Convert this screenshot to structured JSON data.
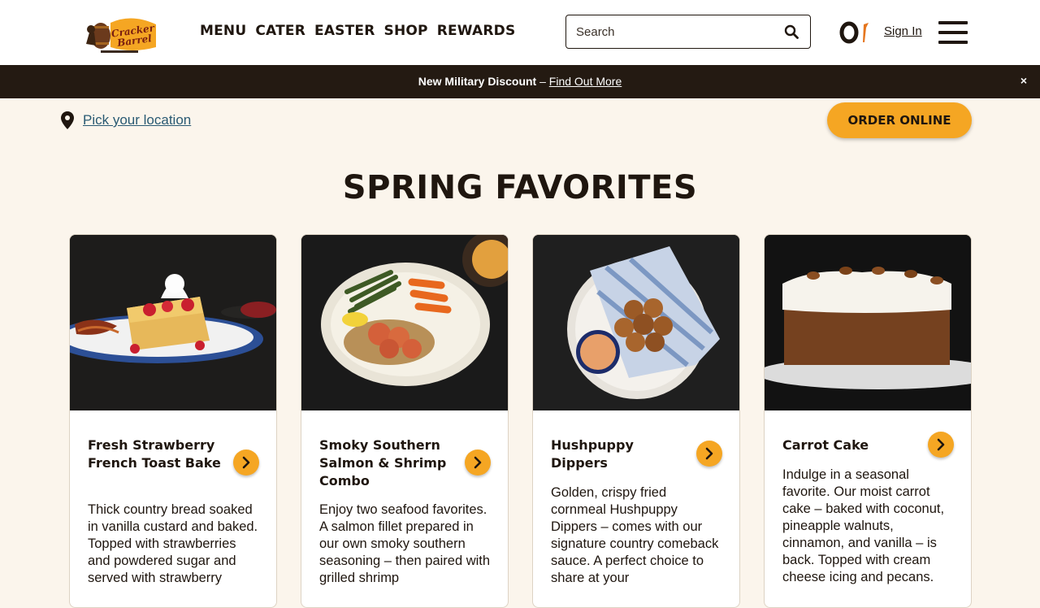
{
  "brand": {
    "logo_alt": "Cracker Barrel Old Country Store"
  },
  "nav": {
    "items": [
      "MENU",
      "CATER",
      "EASTER",
      "SHOP",
      "REWARDS"
    ]
  },
  "search": {
    "placeholder": "Search"
  },
  "account": {
    "signin_label": "Sign In"
  },
  "banner": {
    "text": "New Military Discount",
    "separator": " – ",
    "link_label": "Find Out More",
    "close_label": "×"
  },
  "location": {
    "link_label": "Pick your location"
  },
  "order": {
    "label": "ORDER ONLINE"
  },
  "section": {
    "title": "SPRING FAVORITES"
  },
  "cards": [
    {
      "title": "Fresh Strawberry French Toast Bake",
      "description": "Thick country bread soaked in vanilla custard and baked. Topped with strawberries and powdered sugar and served with strawberry"
    },
    {
      "title": "Smoky Southern Salmon & Shrimp Combo",
      "description": "Enjoy two seafood favorites. A salmon fillet prepared in our own smoky southern seasoning – then paired with grilled shrimp"
    },
    {
      "title": "Hushpuppy Dippers",
      "description": "Golden, crispy fried cornmeal Hushpuppy Dippers – comes with our signature country comeback sauce. A perfect choice to share at your"
    },
    {
      "title": "Carrot Cake",
      "description": "Indulge in a seasonal favorite. Our moist carrot cake – baked with coconut, pineapple walnuts, cinnamon, and vanilla – is back. Topped with cream cheese icing and pecans."
    }
  ],
  "colors": {
    "accent": "#f5a623",
    "dark": "#241a12",
    "page_bg": "#fbf5ec",
    "link": "#2a5a73"
  }
}
